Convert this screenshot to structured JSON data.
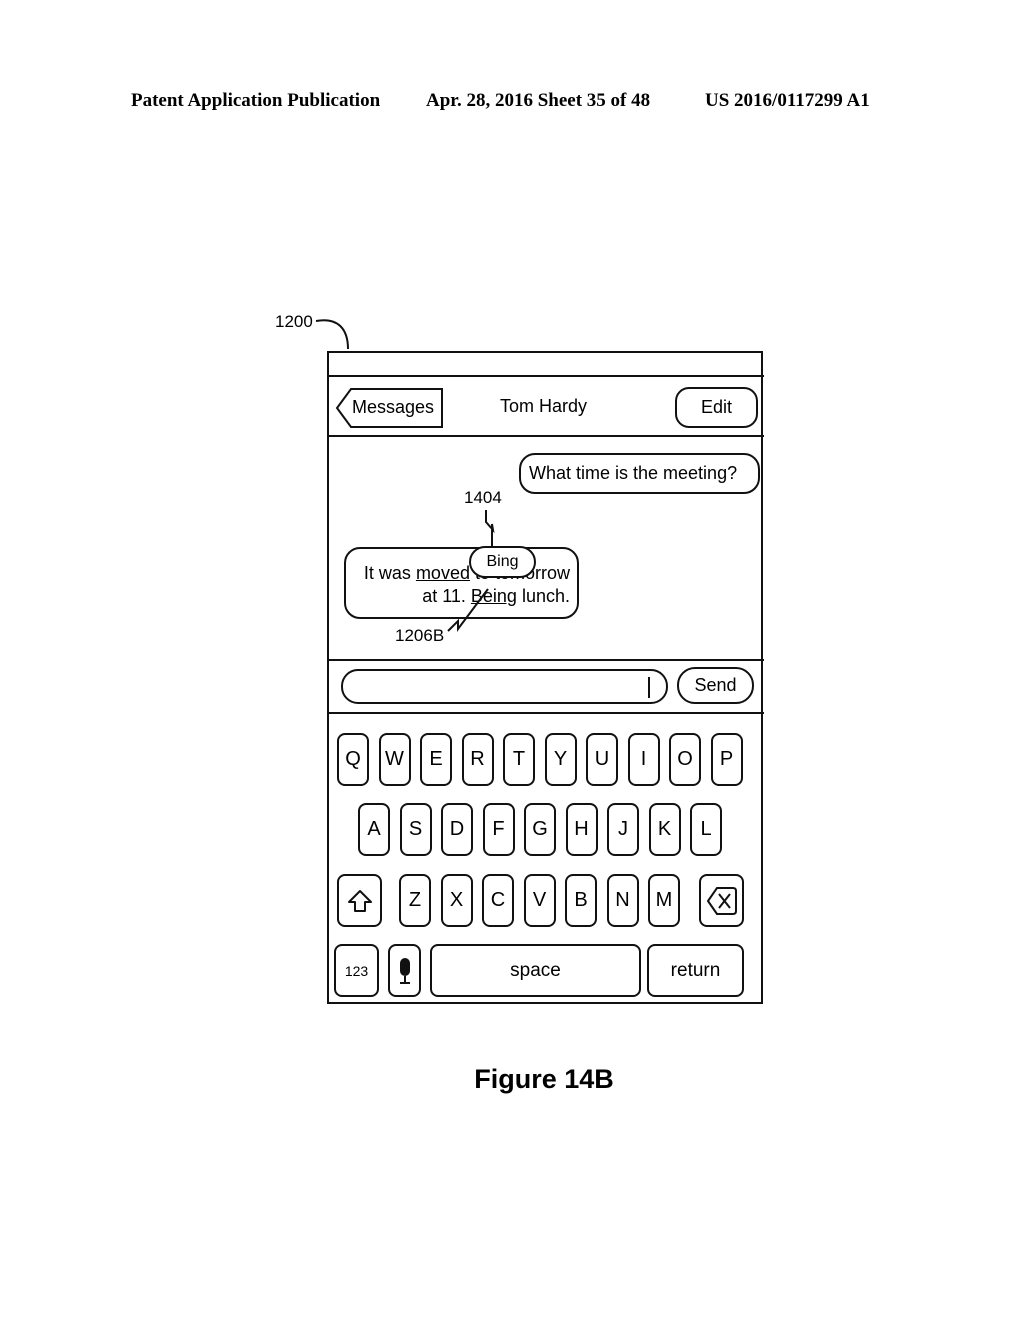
{
  "patent_header": {
    "publication_label": "Patent Application Publication",
    "date_sheet": "Apr. 28, 2016  Sheet 35 of 48",
    "patent_number": "US 2016/0117299 A1"
  },
  "reference_labels": {
    "device": "1200",
    "suggestion": "1404",
    "misspelled_word": "1206B"
  },
  "nav_bar": {
    "back_label": "Messages",
    "title": "Tom Hardy",
    "edit_label": "Edit"
  },
  "messages": {
    "outgoing": "What time is the meeting?",
    "incoming": {
      "part1": "It was ",
      "word_moved": "moved",
      "part2": " to tomorrow",
      "part3": "at 11. ",
      "word_being": "Being",
      "part4": " lunch."
    },
    "suggestion": "Bing"
  },
  "compose": {
    "input_value": "",
    "send_label": "Send"
  },
  "keyboard": {
    "row1": [
      "Q",
      "W",
      "E",
      "R",
      "T",
      "Y",
      "U",
      "I",
      "O",
      "P"
    ],
    "row2": [
      "A",
      "S",
      "D",
      "F",
      "G",
      "H",
      "J",
      "K",
      "L"
    ],
    "row3": [
      "Z",
      "X",
      "C",
      "V",
      "B",
      "N",
      "M"
    ],
    "numbers_label": "123",
    "space_label": "space",
    "return_label": "return"
  },
  "figure_caption": "Figure 14B"
}
